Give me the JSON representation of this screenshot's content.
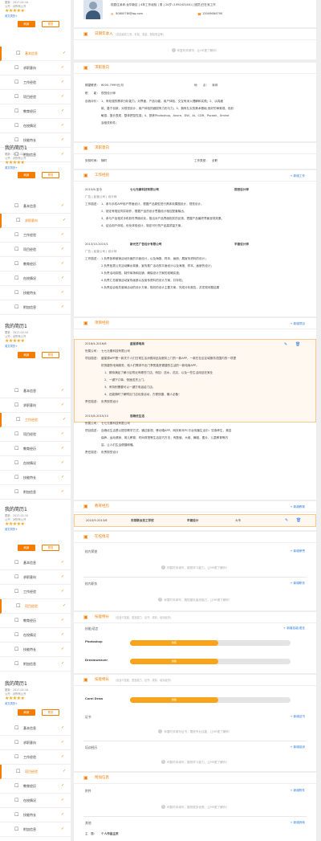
{
  "resume_cards": [
    {
      "title": "",
      "updated": "更新：2017-02-10",
      "visibility": "公开：对所有公开",
      "rate": "",
      "sub": "英文简历+",
      "refresh": "刷新",
      "preview": "预览"
    },
    {
      "title": "我的简历1",
      "updated": "更新：2017-02-10",
      "visibility": "公开：对所有公开",
      "rate": "",
      "sub": "英文简历+",
      "refresh": "刷新",
      "preview": "预览"
    },
    {
      "title": "我的简历1",
      "updated": "更新：2017-02-10",
      "visibility": "公开：对所有公开",
      "rate": "",
      "sub": "英文简历+",
      "refresh": "刷新",
      "preview": "预览"
    },
    {
      "title": "我的简历1",
      "updated": "更新：2017-02-10",
      "visibility": "公开：对所有公开",
      "rate": "",
      "sub": "英文简历+",
      "refresh": "刷新",
      "preview": "预览"
    },
    {
      "title": "我的简历1",
      "updated": "更新：2017-02-10",
      "visibility": "公开：对所有公开",
      "rate": "",
      "sub": "英文简历+",
      "refresh": "刷新",
      "preview": "预览"
    }
  ],
  "stars": "★★★★★",
  "nav_items": [
    "基本信息",
    "求职意向",
    "工作经验",
    "项目经验",
    "教育经历",
    "在校情况",
    "技能特长",
    "附加信息"
  ],
  "profile": {
    "line1": "现居住深圳-龙华新区 | 4年工作经验 | 男 | 24岁 (1992/05/04) | 团员|已在深工作",
    "email": "5080078I@qq.com",
    "phone": "13049684790"
  },
  "self_intro": {
    "title": "日期年收入",
    "hint": "(包括最高工资、补贴、奖金、股权收益等)",
    "empty": "你暂时未填写，让HR更了解你！"
  },
  "intent": {
    "title": "求职意向",
    "salary_label": "期望薪资：",
    "salary": "6000-7999元/月",
    "place_label": "地　　点：",
    "place": "深圳",
    "job_label": "职　　能：",
    "job": "视觉设计师",
    "eval_label": "自我评价：",
    "eval_1": "1、有较强的需求分析能力，对界面、产品功能、用户体验、交互有深入理解和实践；2、认真细",
    "eval_2": "致，善于创新，对视觉设计、用户体验的细腻有力形与力；3、拥有扎实的美术基础,良好的审美观、色彩",
    "eval_3": "敏感，擅长表现，整体把控性强；4、熟练Photoshop、Axure、DW、AI、CDR、Pscook、Xmind",
    "eval_4": "及相关软件；"
  },
  "intent2": {
    "title": "求职意向",
    "time_label": "到岗时间：",
    "time": "随时",
    "type_label": "工作类型：",
    "type": "全职"
  },
  "work": {
    "title": "工作经验",
    "add": "+ 新增工作",
    "jobs": [
      {
        "period": "2015/6-至今",
        "company": "七七元素科技有限公司",
        "role": "视觉设计师",
        "info": "广告 | 民营公司 | 设计师",
        "desc_label": "工作描述：",
        "lines": [
          "1、参与手机APP用户界面设计，根据产品原型进行具体效果图设计，视觉设计。",
          "2、按定有规定同并制作，根据产品的设计思路设计相应配套输出。",
          "3、参与产品相关手机软件界面优化，推出对产品界面相关的反馈，把握产品最终界面呈现效果。",
          "4、结合用户体验，优化体验设计，制定可行的产品高质量方案。"
        ]
      },
      {
        "period": "2013/10-2015/1",
        "company": "新光艺广告设计有限公司",
        "role": "平面设计师",
        "info": "广告 | 民营公司 | 设计师",
        "desc_label": "工作描述：",
        "lines": [
          "1.负责各种营销活动页面的平面设计，以及海报、样本、画册、展宣传资料的设计；",
          "2.负责各类公关活动舞台背景、宣传推广活动的平面设计以及海报、样本、画册的设计；",
          "3.负责活动扣图，制作商场和店铺，确保设计方案的准确实施；",
          "4.负责汇总营销活动宣传画册以及宣传资料的设计方案，并存档；",
          "5.负责结合相关营销活动的设计方案，规划的设计主要方案，完成分析报告，并发现问题结果"
        ]
      }
    ]
  },
  "project": {
    "title": "项目经验",
    "add": "+ 新增项目",
    "items": [
      {
        "period": "2016/4-2016/6",
        "name": "盛星源电商",
        "owner_label": "所属公司：",
        "owner": "七七元素科技有限公司",
        "desc_label": "项目描述：",
        "desc": [
          "盛星源APP是一款关于人们日常生活消费用品及服务上门的一款APP，一款在社区区域服务范围内的一项提",
          "供快捷的电商服务，他人们需求不出门享受高质便捷的生活的一款电商APP。"
        ],
        "points": [
          "1、期待满足了解小区附近有哪些门店，例如：送水，花店，以及一些生活用品在家业",
          "2、一键下订单，快速送货上门。",
          "3、有特别需要可以一键打电话给门店。",
          "4、还能随时了解附近门店优惠活动，方便快捷，懒人必备！"
        ],
        "duty_label": "责任描述：",
        "duty": "负责视觉设计"
      },
      {
        "period": "2015/8-2015/10",
        "name": "百峰优生活",
        "owner_label": "所属公司：",
        "owner": "七七元素科技有限公司",
        "desc_label": "项目描述：",
        "desc": [
          "百峰优生活是以提供教学方式，通过影视、移动端APP、网页和本PC平台传播生活中：饮食养生、美容",
          "保养、运动健身、育儿教育、时尚穿搭等生活技巧方法，有数值、大纲、舞蹈、图片、儿童教育等内",
          "容，让人们生活便捷和懂。"
        ],
        "points": [],
        "duty_label": "责任描述：",
        "duty": "负责视觉设计"
      }
    ]
  },
  "education": {
    "title": "教育经历",
    "add": "+ 新增教育",
    "period": "2010/9-2013/6",
    "school": "东莞联合技工学校",
    "major": "平面设计",
    "degree": "大专"
  },
  "campus": {
    "title": "在校情况",
    "honors_label": "校内荣誉",
    "honors_add": "+ 新增荣誉",
    "honors_empty": "你暂时未填写，展现学习能力，让HR更了解你！",
    "jobs_label": "校内职务",
    "jobs_add": "+ 新增职务",
    "jobs_empty": "你暂时未填写，展现团队组织能力，让HR更了解你！"
  },
  "skills": {
    "title": "技能特长",
    "hint": "(包含IT技能、语言能力、证书、成绩、培训经历)",
    "sub": "技能/语言",
    "add": "+ 新增技能/语言",
    "items": [
      {
        "name": "Photoshop",
        "level_text": "熟练",
        "level": 0.55
      },
      {
        "name": "Dreamweaver",
        "level_text": "熟练",
        "level": 0.55
      }
    ]
  },
  "skills2": {
    "title": "技能特长",
    "hint": "(包含IT技能、语言能力、证书、成绩、培训经历)",
    "items": [
      {
        "name": "Corel Draw",
        "level_text": "熟练",
        "level": 0.55
      }
    ],
    "cert_label": "证书",
    "cert_add": "+ 新增证书",
    "cert_empty": "你暂时未填写证书，展现专业技能，让HR更了解你！",
    "train_label": "培训经历",
    "train_add": "+ 新增培训",
    "train_empty": "你暂时未填写，展现学习能力，让HR更了解你！"
  },
  "extra": {
    "title": "附加信息",
    "attach_label": "附件",
    "attach_add": "+ 新增附件",
    "attach_empty": "你暂时未填写，展现更多优势，让HR更了解你！",
    "other_label": "其他",
    "other_add": "+ 新增其他",
    "other_title_label": "主　题：",
    "other_title": "个人作品主页"
  }
}
